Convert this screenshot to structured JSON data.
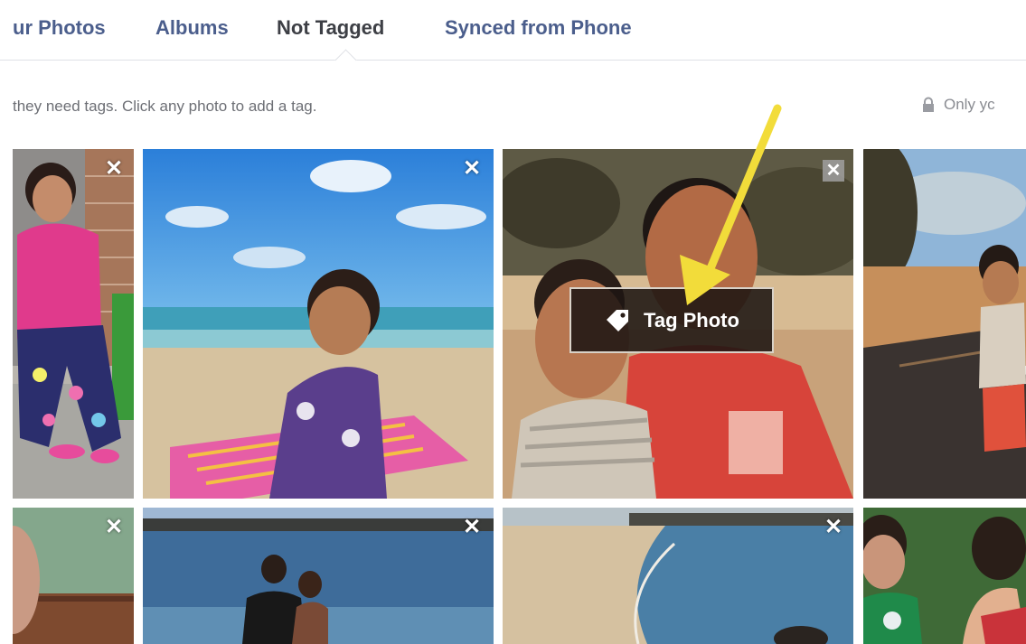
{
  "tabs": [
    {
      "label": "ur Photos"
    },
    {
      "label": "Albums"
    },
    {
      "label": "Not Tagged"
    },
    {
      "label": "Synced from Phone"
    }
  ],
  "info_text": "they need tags. Click any photo to add a tag.",
  "privacy_label": "Only yc",
  "tag_button_label": "Tag Photo",
  "close_glyph": "✕",
  "colors": {
    "tab": "#4b5e8c",
    "tab_active": "#3d3f45",
    "arrow": "#f2dc3a"
  },
  "icons": [
    "close-icon",
    "tag-icon",
    "lock-icon",
    "yellow-arrow"
  ]
}
